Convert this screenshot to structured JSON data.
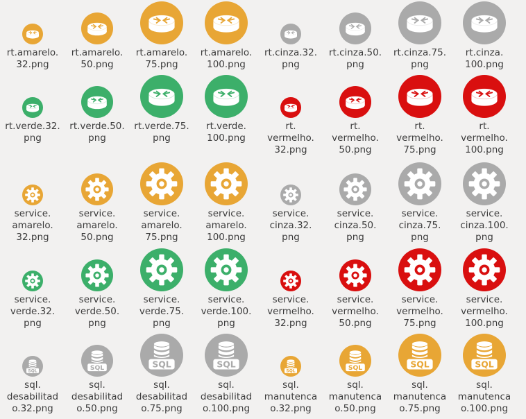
{
  "colors": {
    "amarelo": "#e8a635",
    "cinza": "#aaaaaa",
    "verde": "#3caf6a",
    "vermelho": "#d90f0f",
    "desabilitado": "#aaaaaa",
    "manutencao": "#e8a635"
  },
  "files": [
    {
      "icon": "router-icon",
      "color": "amarelo",
      "size": 32,
      "label": "rt.amarelo.\n32.png"
    },
    {
      "icon": "router-icon",
      "color": "amarelo",
      "size": 50,
      "label": "rt.amarelo.\n50.png"
    },
    {
      "icon": "router-icon",
      "color": "amarelo",
      "size": 75,
      "label": "rt.amarelo.\n75.png"
    },
    {
      "icon": "router-icon",
      "color": "amarelo",
      "size": 100,
      "label": "rt.amarelo.\n100.png"
    },
    {
      "icon": "router-icon",
      "color": "cinza",
      "size": 32,
      "label": "rt.cinza.32.\npng"
    },
    {
      "icon": "router-icon",
      "color": "cinza",
      "size": 50,
      "label": "rt.cinza.50.\npng"
    },
    {
      "icon": "router-icon",
      "color": "cinza",
      "size": 75,
      "label": "rt.cinza.75.\npng"
    },
    {
      "icon": "router-icon",
      "color": "cinza",
      "size": 100,
      "label": "rt.cinza.\n100.png"
    },
    {
      "icon": "router-icon",
      "color": "verde",
      "size": 32,
      "label": "rt.verde.32.\npng"
    },
    {
      "icon": "router-icon",
      "color": "verde",
      "size": 50,
      "label": "rt.verde.50.\npng"
    },
    {
      "icon": "router-icon",
      "color": "verde",
      "size": 75,
      "label": "rt.verde.75.\npng"
    },
    {
      "icon": "router-icon",
      "color": "verde",
      "size": 100,
      "label": "rt.verde.\n100.png"
    },
    {
      "icon": "router-icon",
      "color": "vermelho",
      "size": 32,
      "label": "rt.\nvermelho.\n32.png"
    },
    {
      "icon": "router-icon",
      "color": "vermelho",
      "size": 50,
      "label": "rt.\nvermelho.\n50.png"
    },
    {
      "icon": "router-icon",
      "color": "vermelho",
      "size": 75,
      "label": "rt.\nvermelho.\n75.png"
    },
    {
      "icon": "router-icon",
      "color": "vermelho",
      "size": 100,
      "label": "rt.\nvermelho.\n100.png"
    },
    {
      "icon": "gear-icon",
      "color": "amarelo",
      "size": 32,
      "label": "service.\namarelo.\n32.png"
    },
    {
      "icon": "gear-icon",
      "color": "amarelo",
      "size": 50,
      "label": "service.\namarelo.\n50.png"
    },
    {
      "icon": "gear-icon",
      "color": "amarelo",
      "size": 75,
      "label": "service.\namarelo.\n75.png"
    },
    {
      "icon": "gear-icon",
      "color": "amarelo",
      "size": 100,
      "label": "service.\namarelo.\n100.png"
    },
    {
      "icon": "gear-icon",
      "color": "cinza",
      "size": 32,
      "label": "service.\ncinza.32.\npng"
    },
    {
      "icon": "gear-icon",
      "color": "cinza",
      "size": 50,
      "label": "service.\ncinza.50.\npng"
    },
    {
      "icon": "gear-icon",
      "color": "cinza",
      "size": 75,
      "label": "service.\ncinza.75.\npng"
    },
    {
      "icon": "gear-icon",
      "color": "cinza",
      "size": 100,
      "label": "service.\ncinza.100.\npng"
    },
    {
      "icon": "gear-icon",
      "color": "verde",
      "size": 32,
      "label": "service.\nverde.32.\npng"
    },
    {
      "icon": "gear-icon",
      "color": "verde",
      "size": 50,
      "label": "service.\nverde.50.\npng"
    },
    {
      "icon": "gear-icon",
      "color": "verde",
      "size": 75,
      "label": "service.\nverde.75.\npng"
    },
    {
      "icon": "gear-icon",
      "color": "verde",
      "size": 100,
      "label": "service.\nverde.100.\npng"
    },
    {
      "icon": "gear-icon",
      "color": "vermelho",
      "size": 32,
      "label": "service.\nvermelho.\n32.png"
    },
    {
      "icon": "gear-icon",
      "color": "vermelho",
      "size": 50,
      "label": "service.\nvermelho.\n50.png"
    },
    {
      "icon": "gear-icon",
      "color": "vermelho",
      "size": 75,
      "label": "service.\nvermelho.\n75.png"
    },
    {
      "icon": "gear-icon",
      "color": "vermelho",
      "size": 100,
      "label": "service.\nvermelho.\n100.png"
    },
    {
      "icon": "database-icon",
      "color": "desabilitado",
      "size": 32,
      "label": "sql.\ndesabilitad\no.32.png"
    },
    {
      "icon": "database-icon",
      "color": "desabilitado",
      "size": 50,
      "label": "sql.\ndesabilitad\no.50.png"
    },
    {
      "icon": "database-icon",
      "color": "desabilitado",
      "size": 75,
      "label": "sql.\ndesabilitad\no.75.png"
    },
    {
      "icon": "database-icon",
      "color": "desabilitado",
      "size": 100,
      "label": "sql.\ndesabilitad\no.100.png"
    },
    {
      "icon": "database-icon",
      "color": "manutencao",
      "size": 32,
      "label": "sql.\nmanutenca\no.32.png"
    },
    {
      "icon": "database-icon",
      "color": "manutencao",
      "size": 50,
      "label": "sql.\nmanutenca\no.50.png"
    },
    {
      "icon": "database-icon",
      "color": "manutencao",
      "size": 75,
      "label": "sql.\nmanutenca\no.75.png"
    },
    {
      "icon": "database-icon",
      "color": "manutencao",
      "size": 100,
      "label": "sql.\nmanutenca\no.100.png"
    }
  ],
  "sql_text": "SQL"
}
